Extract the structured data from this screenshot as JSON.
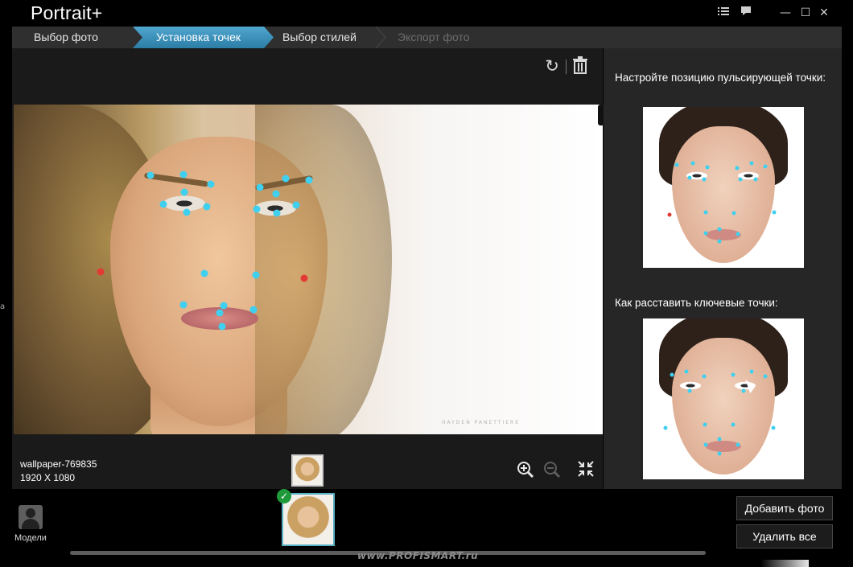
{
  "app": {
    "title": "Portrait+"
  },
  "window_controls": {
    "list_icon": "list-icon",
    "chat_icon": "chat-icon",
    "minimize_glyph": "—",
    "maximize_glyph": "☐",
    "close_glyph": "✕"
  },
  "steps": [
    {
      "label": "Выбор фото",
      "state": "done"
    },
    {
      "label": "Установка точек",
      "state": "active"
    },
    {
      "label": "Выбор стилей",
      "state": "pending"
    },
    {
      "label": "Экспорт фото",
      "state": "disabled"
    }
  ],
  "toolbar": {
    "rotate_icon": "rotate-icon",
    "trash_icon": "trash-icon",
    "rotate_glyph": "↻"
  },
  "photo": {
    "filename": "wallpaper-769835",
    "resolution": "1920 X 1080",
    "watermark": "HAYDEN PANETTIERE"
  },
  "side_panel": {
    "pulse_title": "Настройте позицию пульсирующей точки:",
    "keypoints_title": "Как расставить ключевые точки:"
  },
  "zoom": {
    "in_icon": "zoom-in-icon",
    "out_icon": "zoom-out-icon",
    "fit_icon": "fit-icon"
  },
  "bottom": {
    "models_label": "Модели",
    "add_photo_button": "Добавить фото",
    "remove_all_button": "Удалить все",
    "site_watermark": "www.PROFISMART.ru",
    "check_glyph": "✓"
  },
  "colors": {
    "accent": "#3a93bf",
    "keypoint": "#3fd0ef",
    "pulse_point": "#e23b35",
    "check": "#1f9a3b"
  }
}
